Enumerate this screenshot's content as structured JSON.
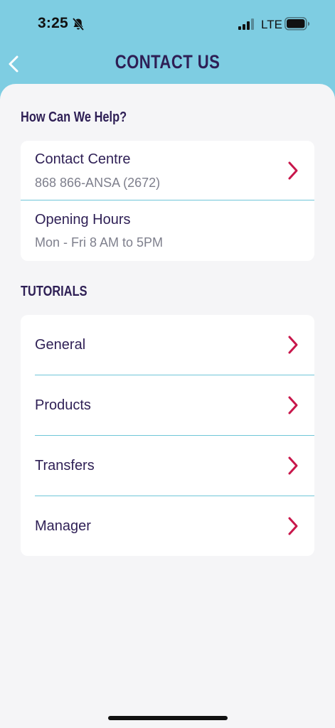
{
  "status": {
    "time": "3:25",
    "network": "LTE",
    "icons": [
      "bell-slash-icon",
      "cellular-signal-icon",
      "battery-icon"
    ]
  },
  "header": {
    "title": "CONTACT US",
    "back_icon": "chevron-left-icon"
  },
  "help": {
    "section_title": "How Can We Help?",
    "contact": {
      "title": "Contact Centre",
      "subtitle": "868 866-ANSA (2672)"
    },
    "hours": {
      "title": "Opening Hours",
      "subtitle": "Mon - Fri 8 AM to 5PM"
    }
  },
  "tutorials": {
    "section_title": "TUTORIALS",
    "items": [
      {
        "label": "General"
      },
      {
        "label": "Products"
      },
      {
        "label": "Transfers"
      },
      {
        "label": "Manager"
      }
    ]
  },
  "colors": {
    "header_bg": "#7ecde2",
    "title_text": "#2e1f55",
    "chevron": "#c8174b",
    "divider": "#6fc6d8",
    "background": "#f5f5f7"
  }
}
